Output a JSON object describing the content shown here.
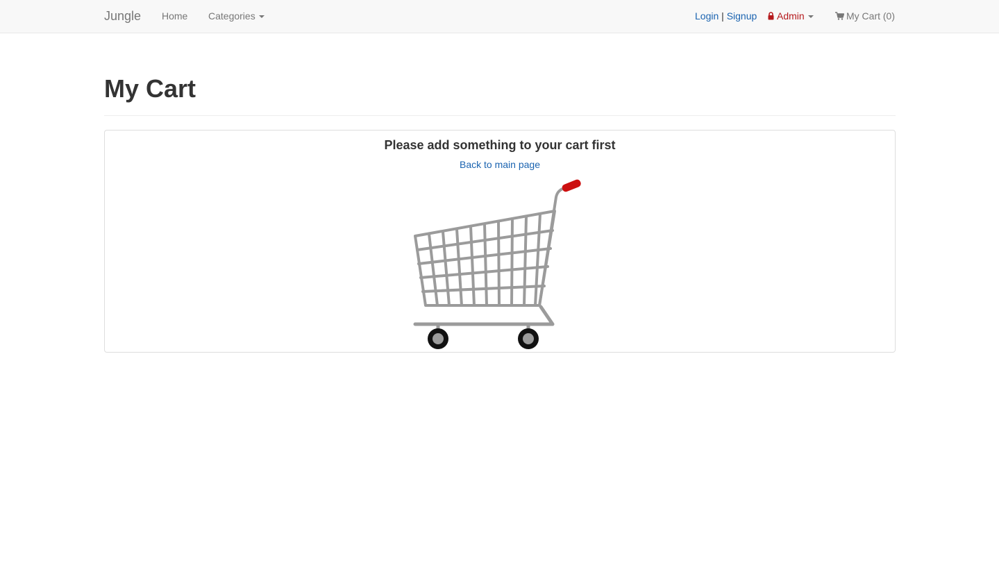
{
  "navbar": {
    "brand": "Jungle",
    "home_label": "Home",
    "categories_label": "Categories",
    "login_label": "Login",
    "separator": "|",
    "signup_label": "Signup",
    "admin_label": "Admin",
    "my_cart_label": "My Cart (0)"
  },
  "page": {
    "title": "My Cart"
  },
  "empty_cart": {
    "message": "Please add something to your cart first",
    "back_link": "Back to main page"
  },
  "colors": {
    "link": "#1a63b0",
    "admin": "#b5191c",
    "navbar_bg": "#f8f8f8",
    "cart_handle": "#cc1010"
  },
  "icons": {
    "lock": "lock-icon",
    "cart": "shopping-cart-icon"
  }
}
